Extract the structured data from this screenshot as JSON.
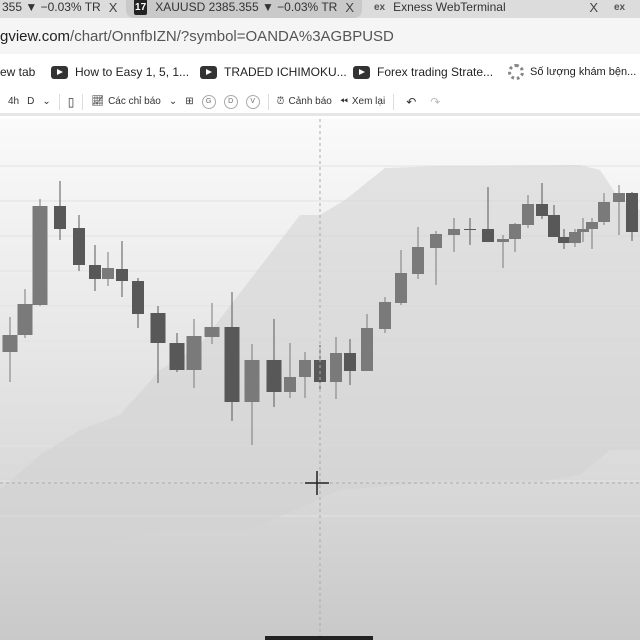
{
  "tabs": [
    {
      "label": "355 ▼ −0.03% TR",
      "close": "X"
    },
    {
      "label": "XAUUSD 2385.355 ▼ −0.03% TR",
      "close": "X",
      "favicon": "17"
    },
    {
      "label": "Exness WebTerminal",
      "close": "X",
      "favicon": "ex"
    },
    {
      "label": "",
      "close": "",
      "favicon": "ex"
    }
  ],
  "url": {
    "host": "gview.com",
    "path": "/chart/OnnfbIZN/?symbol=OANDA%3AGBPUSD"
  },
  "bookmarks": [
    {
      "label": "ew tab",
      "icon": "none"
    },
    {
      "label": "How to Easy 1, 5, 1...",
      "icon": "youtube-icon"
    },
    {
      "label": "TRADED ICHIMOKU...",
      "icon": "youtube-icon"
    },
    {
      "label": "Forex trading Strate...",
      "icon": "youtube-icon"
    },
    {
      "label": "Số lượng khám bện...",
      "icon": "gear-icon"
    }
  ],
  "toolbar": {
    "interval_4h": "4h",
    "interval_d": "D",
    "chevron": "⌄",
    "indicators": "Các chỉ báo",
    "g": "G",
    "d": "D",
    "v": "V",
    "alert": "Cảnh báo",
    "replay": "Xem lại",
    "undo": "↶",
    "redo": "↷"
  },
  "colors": {
    "candle_up": "#7a7a7a",
    "candle_down": "#585858",
    "cloud": "#d2d2d2"
  }
}
